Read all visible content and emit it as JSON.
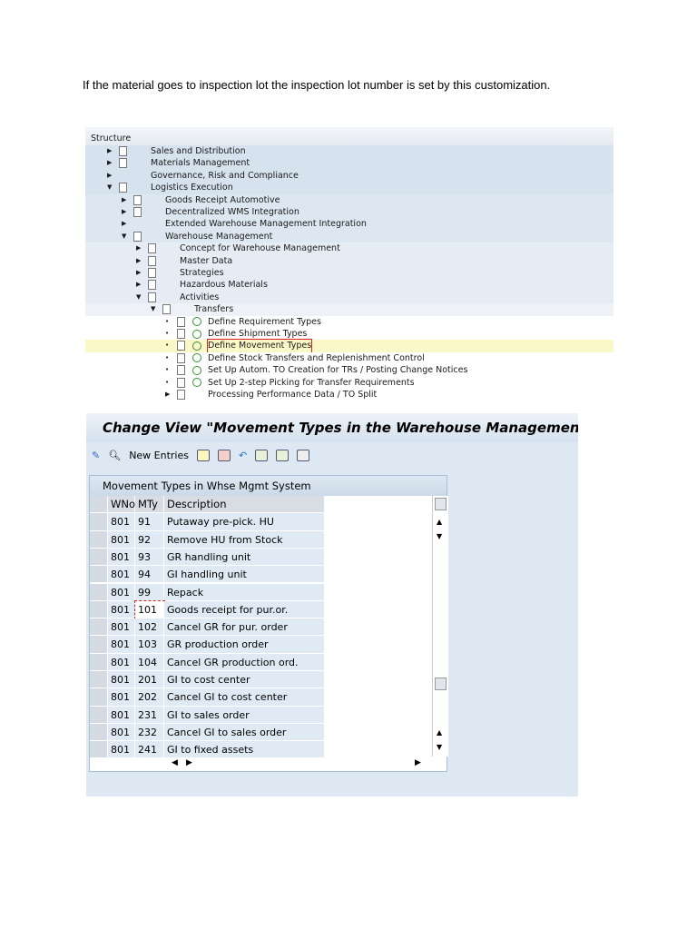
{
  "paragraph": "If the material goes to inspection lot the inspection lot number is set by this customization.",
  "tree": {
    "header": "Structure",
    "nodes": [
      {
        "label": "Sales and Distribution",
        "level": 0,
        "expander": "collapsed",
        "doc": true,
        "clock": false
      },
      {
        "label": "Materials Management",
        "level": 0,
        "expander": "collapsed",
        "doc": true,
        "clock": false
      },
      {
        "label": "Governance, Risk and Compliance",
        "level": 0,
        "expander": "collapsed",
        "doc": false,
        "clock": false
      },
      {
        "label": "Logistics Execution",
        "level": 0,
        "expander": "expanded",
        "doc": true,
        "clock": false
      },
      {
        "label": "Goods Receipt Automotive",
        "level": 1,
        "expander": "collapsed",
        "doc": true,
        "clock": false
      },
      {
        "label": "Decentralized WMS Integration",
        "level": 1,
        "expander": "collapsed",
        "doc": true,
        "clock": false
      },
      {
        "label": "Extended Warehouse Management Integration",
        "level": 1,
        "expander": "collapsed",
        "doc": false,
        "clock": false
      },
      {
        "label": "Warehouse Management",
        "level": 1,
        "expander": "expanded",
        "doc": true,
        "clock": false
      },
      {
        "label": "Concept for Warehouse Management",
        "level": 2,
        "expander": "collapsed",
        "doc": true,
        "clock": false
      },
      {
        "label": "Master Data",
        "level": 2,
        "expander": "collapsed",
        "doc": true,
        "clock": false
      },
      {
        "label": "Strategies",
        "level": 2,
        "expander": "collapsed",
        "doc": true,
        "clock": false
      },
      {
        "label": "Hazardous Materials",
        "level": 2,
        "expander": "collapsed",
        "doc": true,
        "clock": false
      },
      {
        "label": "Activities",
        "level": 2,
        "expander": "expanded",
        "doc": true,
        "clock": false
      },
      {
        "label": "Transfers",
        "level": 3,
        "expander": "expanded",
        "doc": true,
        "clock": false
      },
      {
        "label": "Define Requirement Types",
        "level": 4,
        "expander": "leaf",
        "doc": true,
        "clock": true
      },
      {
        "label": "Define Shipment Types",
        "level": 4,
        "expander": "leaf",
        "doc": true,
        "clock": true
      },
      {
        "label": "Define Movement Types",
        "level": 4,
        "expander": "leaf",
        "doc": true,
        "clock": true,
        "highlighted": true
      },
      {
        "label": "Define Stock Transfers and Replenishment Control",
        "level": 4,
        "expander": "leaf",
        "doc": true,
        "clock": true
      },
      {
        "label": "Set Up Autom. TO Creation for TRs / Posting Change Notices",
        "level": 4,
        "expander": "leaf",
        "doc": true,
        "clock": true
      },
      {
        "label": "Set Up 2-step Picking for Transfer Requirements",
        "level": 4,
        "expander": "leaf",
        "doc": true,
        "clock": true
      },
      {
        "label": "Processing Performance Data / TO Split",
        "level": 4,
        "expander": "collapsed",
        "doc": true,
        "clock": false
      }
    ]
  },
  "view": {
    "title": "Change View \"Movement Types in the Warehouse Management",
    "new_entries": "New Entries",
    "table_title": "Movement Types in Whse Mgmt System",
    "columns": [
      "WNo",
      "MTy",
      "Description"
    ],
    "rows": [
      [
        "801",
        "91",
        "Putaway pre-pick. HU"
      ],
      [
        "801",
        "92",
        "Remove HU from Stock"
      ],
      [
        "801",
        "93",
        "GR handling unit"
      ],
      [
        "801",
        "94",
        "GI handling unit"
      ],
      [
        "801",
        "99",
        "Repack"
      ],
      [
        "801",
        "101",
        "Goods receipt for pur.or."
      ],
      [
        "801",
        "102",
        "Cancel GR for pur. order"
      ],
      [
        "801",
        "103",
        "GR production order"
      ],
      [
        "801",
        "104",
        "Cancel GR production ord."
      ],
      [
        "801",
        "201",
        "GI to cost center"
      ],
      [
        "801",
        "202",
        "Cancel GI to cost center"
      ],
      [
        "801",
        "231",
        "GI to sales order"
      ],
      [
        "801",
        "232",
        "Cancel GI to sales order"
      ],
      [
        "801",
        "241",
        "GI to fixed assets"
      ]
    ]
  }
}
